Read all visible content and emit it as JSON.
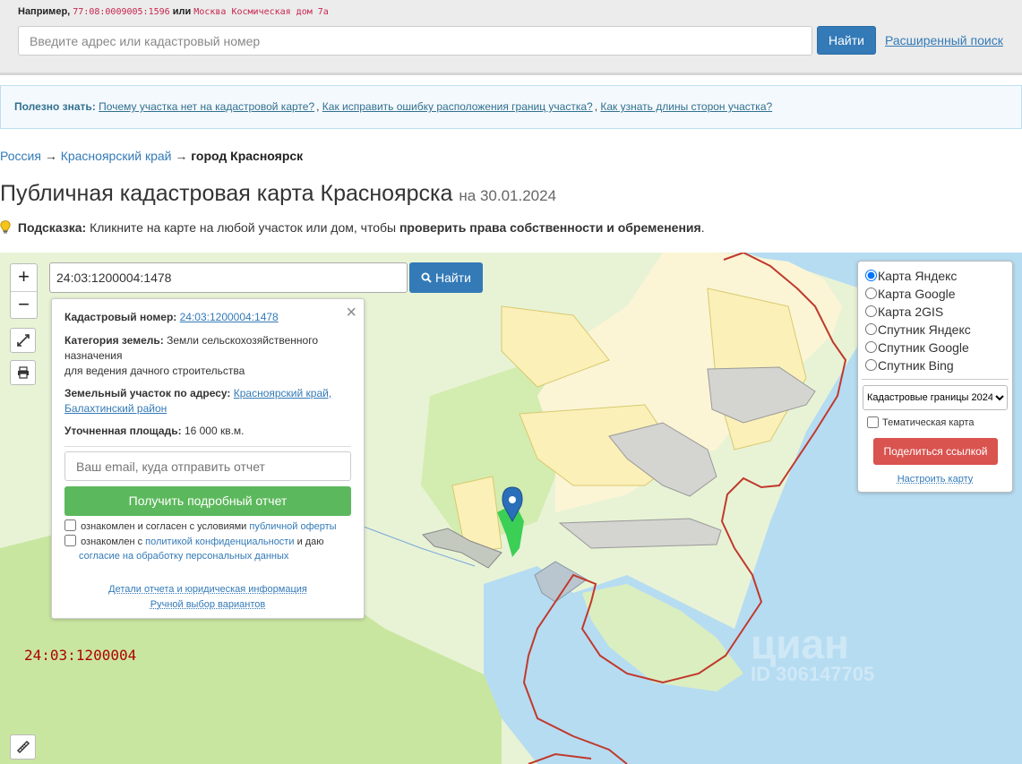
{
  "search": {
    "example_prefix": "Например,",
    "example_code": "77:08:0009005:1596",
    "example_or": "или",
    "example_address": "Москва Космическая дом 7а",
    "placeholder": "Введите адрес или кадастровый номер",
    "find_label": "Найти",
    "advanced_link": "Расширенный поиск"
  },
  "info": {
    "label": "Полезно знать:",
    "links": [
      "Почему участка нет на кадастровой карте?",
      "Как исправить ошибку расположения границ участка?",
      "Как узнать длины сторон участка?"
    ]
  },
  "breadcrumb": {
    "items": [
      "Россия",
      "Красноярский край"
    ],
    "current": "город Красноярск",
    "separator": "→"
  },
  "page": {
    "title": "Публичная кадастровая карта Красноярска",
    "date": "на 30.01.2024",
    "hint_label": "Подсказка:",
    "hint_text": "Кликните на карте на любой участок или дом, чтобы",
    "hint_bold": "проверить права собственности и обременения",
    "hint_end": "."
  },
  "map": {
    "search_value": "24:03:1200004:1478",
    "find_label": "Найти",
    "zoom_in": "+",
    "zoom_out": "−",
    "quarter_label": "24:03:1200004",
    "watermark": "циан",
    "watermark_id": "ID 306147705"
  },
  "popup": {
    "cad_label": "Кадастровый номер:",
    "cad_value": "24:03:1200004:1478",
    "category_label": "Категория земель:",
    "category_value": "Земли сельскохозяйственного назначения",
    "usage_value": "для ведения дачного строительства",
    "address_label": "Земельный участок по адресу:",
    "address_value": "Красноярский край, Балахтинский район",
    "area_label": "Уточненная площадь:",
    "area_value": "16 000 кв.м.",
    "email_placeholder": "Ваш email, куда отправить отчет",
    "report_button": "Получить подробный отчет",
    "check1_text": "ознакомлен и согласен с условиями",
    "check1_link": "публичной оферты",
    "check2_text": "ознакомлен с",
    "check2_link": "политикой конфиденциальности",
    "check2_mid": "и даю",
    "check2_link2": "согласие на обработку персональных данных",
    "details_link": "Детали отчета и юридическая информация",
    "manual_link": "Ручной выбор вариантов"
  },
  "layers": {
    "options": [
      "Карта Яндекс",
      "Карта Google",
      "Карта 2GIS",
      "Спутник Яндекс",
      "Спутник Google",
      "Спутник Bing"
    ],
    "selected": "Карта Яндекс",
    "select_value": "Кадастровые границы 2024",
    "thematic_label": "Тематическая карта",
    "share_button": "Поделиться ссылкой",
    "setup_link": "Настроить карту"
  },
  "colors": {
    "primary": "#337ab7",
    "success": "#5cb85c",
    "danger": "#d9534f",
    "water": "#b6dcf2",
    "land": "#e8f3d6",
    "forest": "#c9e6a0",
    "boundary": "#c0392b"
  }
}
